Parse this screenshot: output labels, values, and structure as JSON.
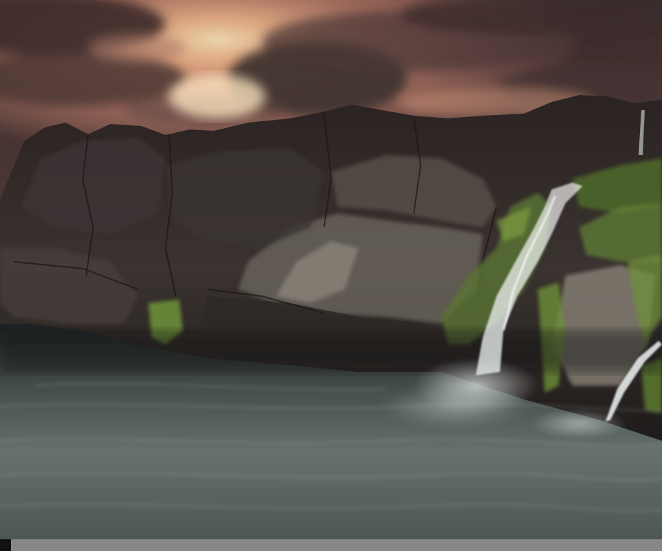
{
  "photo": {
    "subject": "",
    "colors": {
      "sky_top": "#3b2b2b",
      "sky_glow": "#f7d2a4",
      "sky_orange": "#d98a66",
      "sky_pink": "#b87a70",
      "cloud_dark": "#4a3836",
      "rock_dark": "#2b2422",
      "rock_mid": "#3e3633",
      "rock_light": "#8b8478",
      "moss": "#5f7a35",
      "moss_bright": "#7da03b",
      "water_top": "#2d3433",
      "water_mid": "#55605a",
      "water_light": "#7c8984",
      "foam": "#e9eef0",
      "strip": "#878787"
    }
  },
  "ui": {
    "bottom_bar_color": "#878787"
  }
}
